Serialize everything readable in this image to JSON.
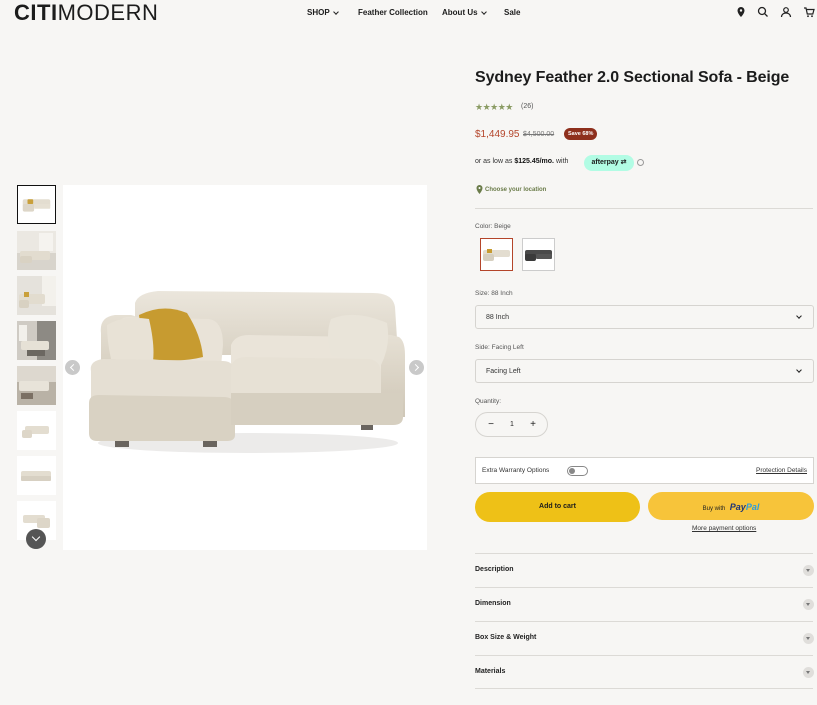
{
  "header": {
    "logo_bold": "CITI",
    "logo_light": "MODERN",
    "nav": [
      {
        "label": "SHOP",
        "has_dropdown": true
      },
      {
        "label": "Feather Collection",
        "has_dropdown": false
      },
      {
        "label": "About Us",
        "has_dropdown": true
      },
      {
        "label": "Sale",
        "has_dropdown": false
      }
    ],
    "icons": [
      "location-icon",
      "search-icon",
      "account-icon",
      "cart-icon"
    ]
  },
  "gallery": {
    "thumbnail_count": 8,
    "selected_index": 0
  },
  "product": {
    "title": "Sydney Feather 2.0 Sectional Sofa - Beige",
    "rating_stars": "★★★★★",
    "rating_value": 5,
    "review_count": "(26)",
    "price": "$1,449.95",
    "compare_price": "$4,500.00",
    "save_badge": "Save 68%",
    "installment_prefix": "or as low as",
    "installment_amount": "$125.45/mo.",
    "installment_suffix": "with",
    "afterpay_label": "afterpay",
    "location_link": "Choose your location",
    "color_label": "Color: Beige",
    "size_label": "Size:  88 Inch",
    "size_value": "88 Inch",
    "side_label": "Side:  Facing Left",
    "side_value": "Facing Left",
    "quantity_label": "Quantity:",
    "quantity_minus": "−",
    "quantity_value": "1",
    "quantity_plus": "+",
    "warranty_label": "Extra Warranty Options",
    "warranty_link": "Protection Details",
    "add_to_cart": "Add to cart",
    "paypal_prefix": "Buy with",
    "paypal_pay": "Pay",
    "paypal_pal": "Pal",
    "more_payment": "More payment options",
    "accordions": [
      "Description",
      "Dimension",
      "Box Size & Weight",
      "Materials"
    ]
  },
  "colors": {
    "accent_price": "#b4452a",
    "cart_button": "#eec117",
    "paypal_button": "#f7c43a",
    "afterpay_badge": "#b2fce4",
    "stars": "#8a9b63"
  }
}
